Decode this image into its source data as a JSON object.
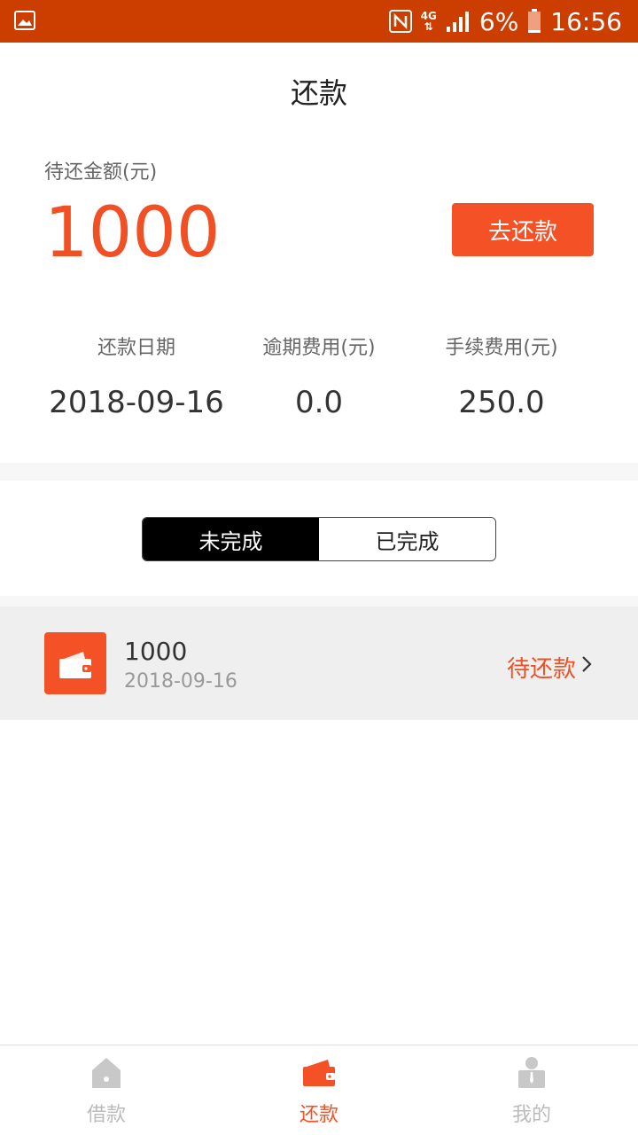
{
  "statusbar": {
    "battery": "6%",
    "time": "16:56",
    "network": "4G"
  },
  "header": {
    "title": "还款"
  },
  "summary": {
    "due_label": "待还金额(元)",
    "due_amount": "1000",
    "pay_button": "去还款"
  },
  "info": [
    {
      "label": "还款日期",
      "value": "2018-09-16"
    },
    {
      "label": "逾期费用(元)",
      "value": "0.0"
    },
    {
      "label": "手续费用(元)",
      "value": "250.0"
    }
  ],
  "segments": {
    "active": "未完成",
    "inactive": "已完成"
  },
  "list": [
    {
      "amount": "1000",
      "date": "2018-09-16",
      "status": "待还款",
      "icon": "wallet-icon"
    }
  ],
  "tabs": [
    {
      "label": "借款",
      "icon": "home-icon",
      "active": false
    },
    {
      "label": "还款",
      "icon": "wallet-icon",
      "active": true
    },
    {
      "label": "我的",
      "icon": "user-icon",
      "active": false
    }
  ],
  "colors": {
    "accent": "#f45226",
    "statusbar": "#cc3d00",
    "inactive_tab": "#bbbbbb"
  }
}
